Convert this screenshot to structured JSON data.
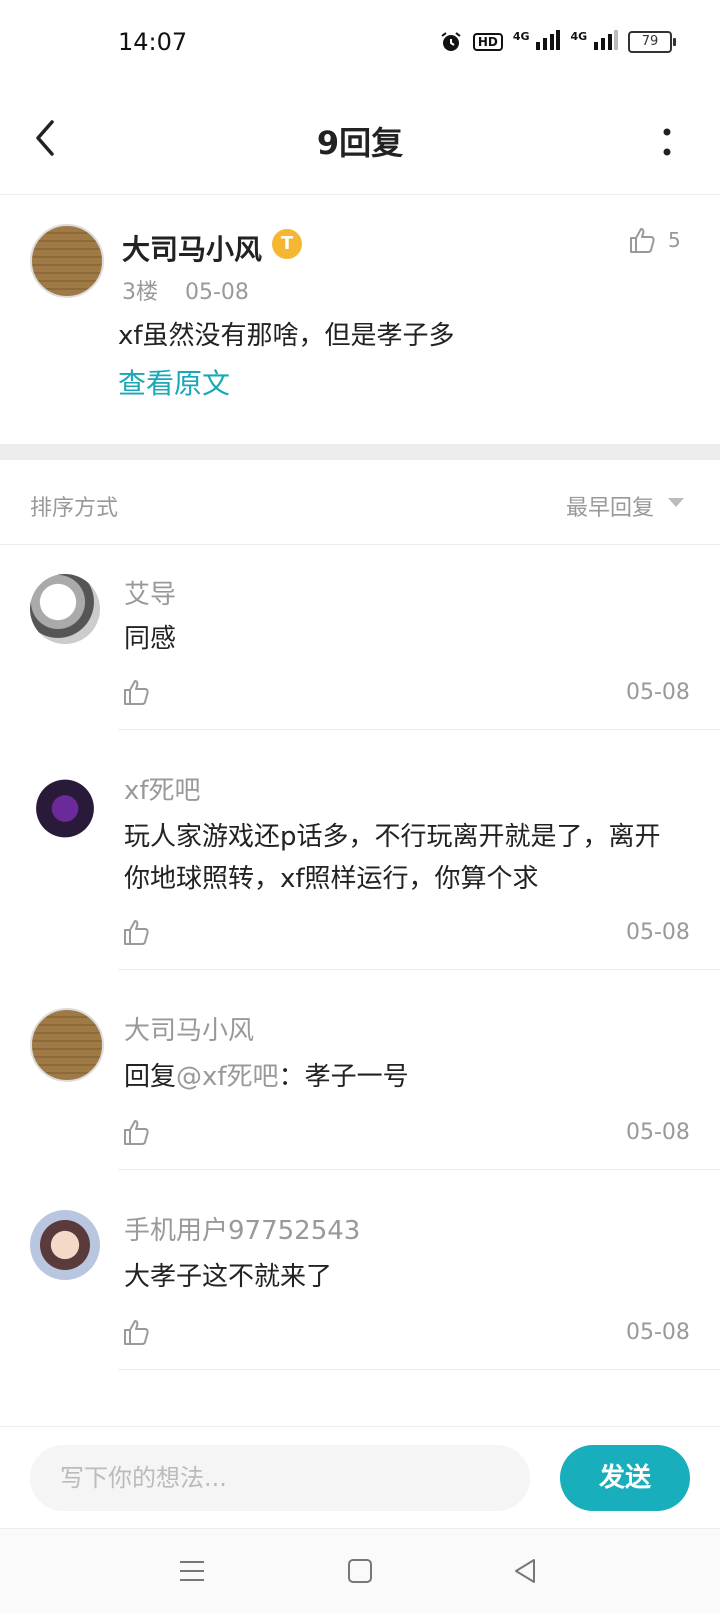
{
  "status_bar": {
    "time": "14:07",
    "icons": [
      "alarm-icon",
      "hd-icon",
      "signal-4g-icon",
      "signal-4g-icon"
    ],
    "hd_label": "HD",
    "net1": "4G",
    "net2": "4G",
    "battery": "79"
  },
  "header": {
    "title": "9回复",
    "back_icon": "back-arrow-icon",
    "more_icon": "more-vertical-icon"
  },
  "post": {
    "author": "大司马小风",
    "badge": "T",
    "floor": "3楼",
    "date": "05-08",
    "text": "xf虽然没有那啥，但是孝子多",
    "view_original": "查看原文",
    "like_count": "5"
  },
  "sort": {
    "label": "排序方式",
    "value": "最早回复"
  },
  "replies": [
    {
      "author": "艾导",
      "text": "同感",
      "date": "05-08"
    },
    {
      "author": "xf死吧",
      "text": "玩人家游戏还p话多，不行玩离开就是了，离开你地球照转，xf照样运行，你算个求",
      "date": "05-08"
    },
    {
      "author": "大司马小风",
      "reply_prefix": "回复",
      "mention": "@xf死吧",
      "reply_suffix": "：孝子一号",
      "date": "05-08"
    },
    {
      "author": "手机用户97752543",
      "text": "大孝子这不就来了",
      "date": "05-08"
    }
  ],
  "composer": {
    "placeholder": "写下你的想法...",
    "send_label": "发送"
  },
  "navbar": {
    "icons": [
      "menu-icon",
      "home-square-icon",
      "back-triangle-icon"
    ]
  },
  "colors": {
    "accent": "#18aebb",
    "link": "#1aa8b8",
    "muted_text": "#999999",
    "badge": "#f5b731"
  }
}
